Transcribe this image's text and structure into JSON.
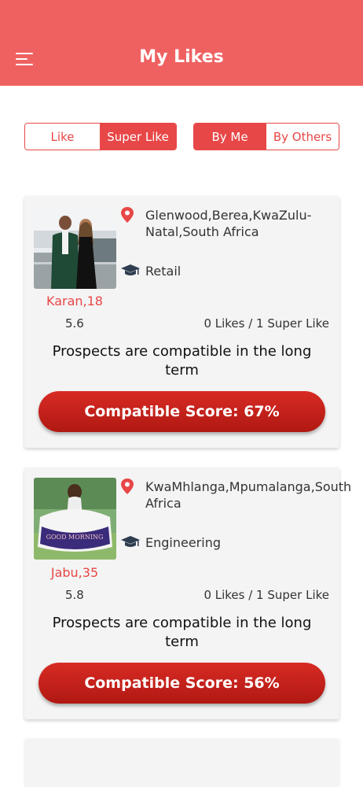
{
  "header": {
    "title": "My Likes"
  },
  "filters": {
    "type": {
      "like": "Like",
      "super_like": "Super Like"
    },
    "source": {
      "by_me": "By Me",
      "by_others": "By Others"
    }
  },
  "profiles": [
    {
      "name_age": "Karan,18",
      "location": "Glenwood,Berea,KwaZulu-Natal,South Africa",
      "occupation": "Retail",
      "score": "5.6",
      "likes": "0 Likes / 1 Super Like",
      "compatibility_text": "Prospects are compatible in the long term",
      "compatible_score": "Compatible Score: 67%"
    },
    {
      "name_age": "Jabu,35",
      "location": "KwaMhlanga,Mpumalanga,South Africa",
      "occupation": "Engineering",
      "score": "5.8",
      "likes": "0 Likes / 1 Super Like",
      "compatibility_text": "Prospects are compatible in the long term",
      "compatible_score": "Compatible Score: 56%",
      "photo_text": "GOOD MORNING"
    }
  ],
  "colors": {
    "header": "#ef6161",
    "accent": "#e84747",
    "button": "#c8211b"
  }
}
